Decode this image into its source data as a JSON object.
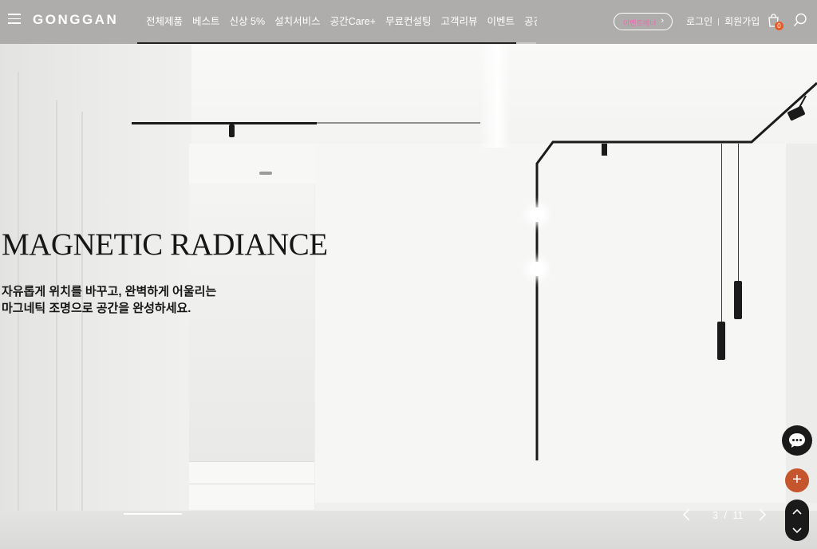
{
  "header": {
    "logo": "GONGGAN",
    "nav": [
      "전체제품",
      "베스트",
      "신상 5%",
      "설치서비스",
      "공간Care+",
      "무료컨설팅",
      "고객리뷰",
      "이벤트",
      "공간소식"
    ],
    "promo_label": "이벤트배너",
    "login": "로그인",
    "signup": "회원가입",
    "cart_count": "0"
  },
  "hero": {
    "headline": "MAGNETIC RADIANCE",
    "subtext_line1": "자유롭게 위치를 바꾸고, 완벽하게 어울리는",
    "subtext_line2": "마그네틱 조명으로 공간을 완성하세요."
  },
  "slider": {
    "current": "3",
    "separator": "/",
    "total": "11"
  },
  "icons": {
    "menu": "menu-icon",
    "bag": "shopping-bag-icon",
    "search": "search-icon",
    "chat": "chat-icon",
    "plus": "plus-icon",
    "prev": "chevron-left-icon",
    "next": "chevron-right-icon",
    "up": "chevron-up-icon",
    "down": "chevron-down-icon"
  },
  "colors": {
    "accent_orange": "#c4552c",
    "badge_orange": "#e65b27",
    "promo_pink": "#ee6ab0",
    "dark": "#1a1a1a"
  }
}
